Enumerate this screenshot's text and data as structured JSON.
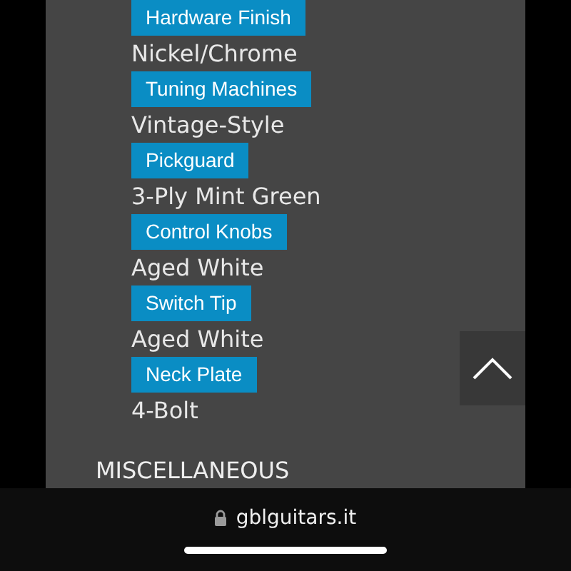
{
  "specs": [
    {
      "label": "Hardware Finish",
      "value": "Nickel/Chrome"
    },
    {
      "label": "Tuning Machines",
      "value": "Vintage-Style"
    },
    {
      "label": "Pickguard",
      "value": "3-Ply Mint Green"
    },
    {
      "label": "Control Knobs",
      "value": "Aged White"
    },
    {
      "label": "Switch Tip",
      "value": "Aged White"
    },
    {
      "label": "Neck Plate",
      "value": "4-Bolt"
    }
  ],
  "section_heading": "MISCELLANEOUS",
  "browser_bar": {
    "url": "gblguitars.it"
  }
}
